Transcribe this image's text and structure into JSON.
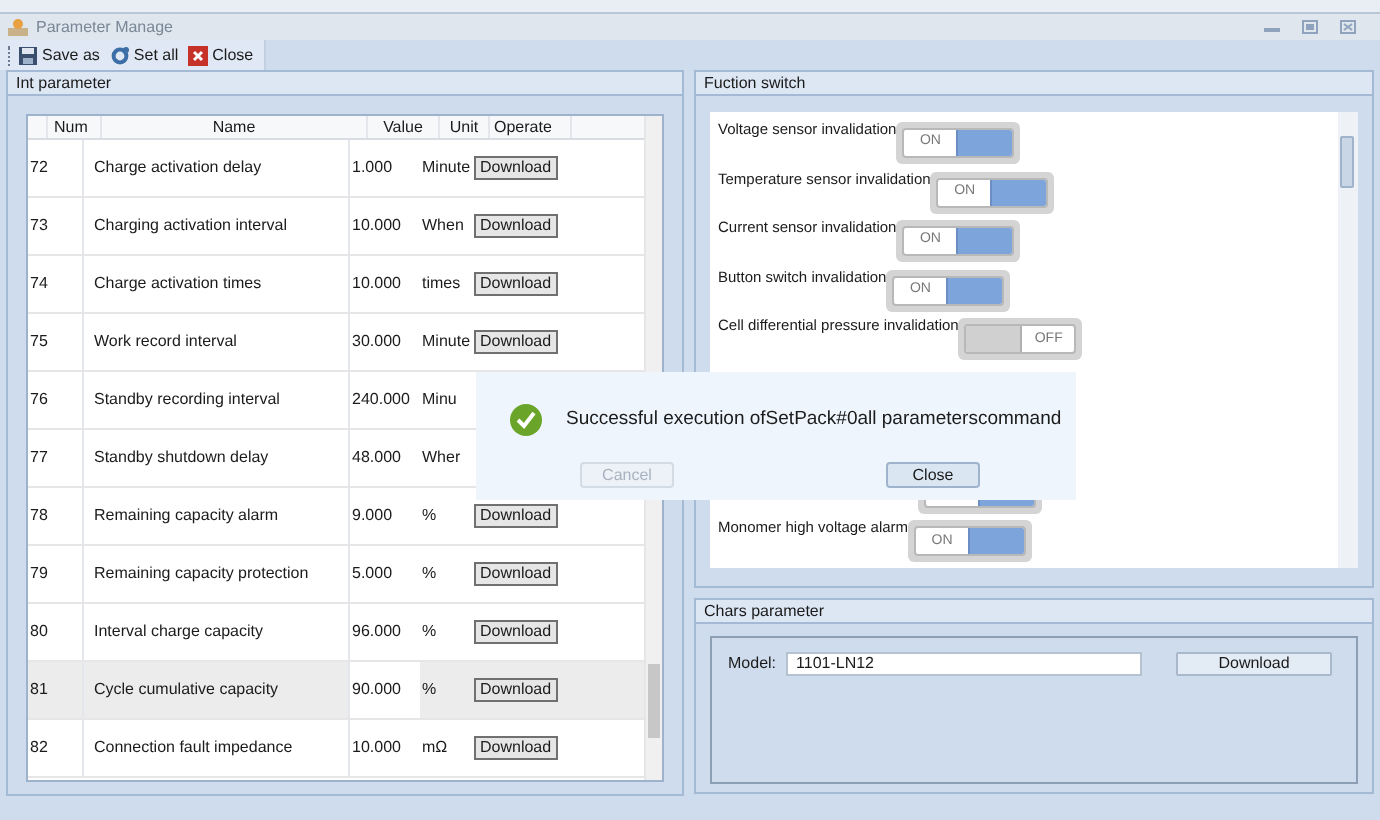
{
  "window": {
    "title": "Parameter Manage"
  },
  "toolbar": [
    {
      "kind": "save",
      "label": "Save as"
    },
    {
      "kind": "gear",
      "label": "Set all"
    },
    {
      "kind": "close",
      "label": "Close"
    }
  ],
  "int_parameter": {
    "title": "Int parameter",
    "columns": [
      "Num",
      "Name",
      "Value",
      "Unit",
      "Operate"
    ],
    "rows": [
      {
        "num": "72",
        "name": "Charge activation delay",
        "value": "1.000",
        "unit": "Minute",
        "operate": "Download",
        "selected": false
      },
      {
        "num": "73",
        "name": "Charging activation interval",
        "value": "10.000",
        "unit": "When",
        "operate": "Download",
        "selected": false
      },
      {
        "num": "74",
        "name": "Charge activation times",
        "value": "10.000",
        "unit": "times",
        "operate": "Download",
        "selected": false
      },
      {
        "num": "75",
        "name": "Work record interval",
        "value": "30.000",
        "unit": "Minute",
        "operate": "Download",
        "selected": false
      },
      {
        "num": "76",
        "name": "Standby recording interval",
        "value": "240.000",
        "unit": "Minu",
        "selected": false
      },
      {
        "num": "77",
        "name": "Standby shutdown delay",
        "value": "48.000",
        "unit": "Wher",
        "selected": false
      },
      {
        "num": "78",
        "name": "Remaining capacity alarm",
        "value": "9.000",
        "unit": "%",
        "operate": "Download",
        "selected": false
      },
      {
        "num": "79",
        "name": "Remaining capacity protection",
        "value": "5.000",
        "unit": "%",
        "operate": "Download",
        "selected": false
      },
      {
        "num": "80",
        "name": "Interval charge capacity",
        "value": "96.000",
        "unit": "%",
        "operate": "Download",
        "selected": false
      },
      {
        "num": "81",
        "name": "Cycle cumulative capacity",
        "value": "90.000",
        "unit": "%",
        "operate": "Download",
        "selected": true
      },
      {
        "num": "82",
        "name": "Connection fault impedance",
        "value": "10.000",
        "unit": "mΩ",
        "operate": "Download",
        "selected": false
      }
    ]
  },
  "function_switch": {
    "title": "Fuction switch",
    "items": [
      {
        "label": "Voltage sensor invalidation",
        "on": true,
        "on_text": "ON"
      },
      {
        "label": "Temperature sensor invalidation",
        "on": true,
        "on_text": "ON"
      },
      {
        "label": "Current sensor invalidation",
        "on": true,
        "on_text": "ON"
      },
      {
        "label": "Button switch invalidation",
        "on": true,
        "on_text": "ON"
      },
      {
        "label": "Cell differential pressure invalidation",
        "on": false,
        "off_text": "OFF"
      },
      {
        "on": true
      },
      {
        "label": "Monomer high voltage alarm",
        "on": true,
        "on_text": "ON"
      }
    ]
  },
  "chars_parameter": {
    "title": "Chars parameter",
    "model_label": "Model:",
    "model_value": "1101-LN12",
    "button": "Download"
  },
  "dialog": {
    "message": "Successful execution ofSetPack#0all parameterscommand",
    "buttons": [
      {
        "label": "Cancel",
        "disabled": true
      },
      {
        "label": "Close",
        "disabled": false
      }
    ]
  }
}
